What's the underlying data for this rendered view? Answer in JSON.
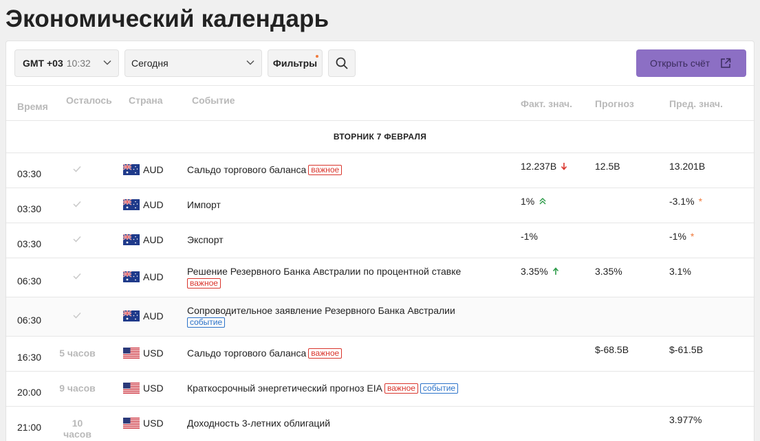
{
  "page": {
    "title": "Экономический календарь"
  },
  "toolbar": {
    "timezone": "GMT +03",
    "clock": "10:32",
    "date_select": "Сегодня",
    "filters_label": "Фильтры",
    "open_account_label": "Открыть счёт"
  },
  "columns": {
    "time": "Время",
    "remaining": "Осталось",
    "country": "Страна",
    "event": "Событие",
    "actual": "Факт. знач.",
    "forecast": "Прогноз",
    "previous": "Пред. знач."
  },
  "day_header": "ВТОРНИК 7 ФЕВРАЛЯ",
  "badges": {
    "important": "важное",
    "event": "событие"
  },
  "colors": {
    "accent": "#8c6fc4",
    "important": "#d9342b",
    "event": "#2a72c9",
    "up": "#2e9c4a",
    "down": "#d9342b",
    "revised": "#f07a3c"
  },
  "rows": [
    {
      "time": "03:30",
      "remaining": "",
      "currency": "AUD",
      "flag": "australia-flag",
      "event": "Сальдо торгового баланса",
      "actual": "12.237B",
      "actual_trend": "down-arrow",
      "forecast": "12.5B",
      "previous": "13.201B",
      "previous_mark": ""
    },
    {
      "time": "03:30",
      "remaining": "",
      "currency": "AUD",
      "flag": "australia-flag",
      "event": "Импорт",
      "actual": "1%",
      "actual_trend": "double-up-arrow",
      "forecast": "",
      "previous": "-3.1%",
      "previous_mark": "*"
    },
    {
      "time": "03:30",
      "remaining": "",
      "currency": "AUD",
      "flag": "australia-flag",
      "event": "Экспорт",
      "actual": "-1%",
      "actual_trend": "",
      "forecast": "",
      "previous": "-1%",
      "previous_mark": "*"
    },
    {
      "time": "06:30",
      "remaining": "",
      "currency": "AUD",
      "flag": "australia-flag",
      "event": "Решение Резервного Банка Австралии по процентной ставке",
      "actual": "3.35%",
      "actual_trend": "up-arrow",
      "forecast": "3.35%",
      "previous": "3.1%",
      "previous_mark": ""
    },
    {
      "time": "06:30",
      "remaining": "",
      "currency": "AUD",
      "flag": "australia-flag",
      "event": "Сопроводительное заявление Резервного Банка Австралии",
      "actual": "",
      "actual_trend": "",
      "forecast": "",
      "previous": "",
      "previous_mark": ""
    },
    {
      "time": "16:30",
      "remaining": "5 часов",
      "currency": "USD",
      "flag": "usa-flag",
      "event": "Сальдо торгового баланса",
      "actual": "",
      "actual_trend": "",
      "forecast": "$-68.5B",
      "previous": "$-61.5B",
      "previous_mark": ""
    },
    {
      "time": "20:00",
      "remaining": "9 часов",
      "currency": "USD",
      "flag": "usa-flag",
      "event": "Краткосрочный энергетический прогноз EIA",
      "actual": "",
      "actual_trend": "",
      "forecast": "",
      "previous": "",
      "previous_mark": ""
    },
    {
      "time": "21:00",
      "remaining": "10 часов",
      "currency": "USD",
      "flag": "usa-flag",
      "event": "Доходность 3-летних облигаций",
      "actual": "",
      "actual_trend": "",
      "forecast": "",
      "previous": "3.977%",
      "previous_mark": ""
    }
  ]
}
